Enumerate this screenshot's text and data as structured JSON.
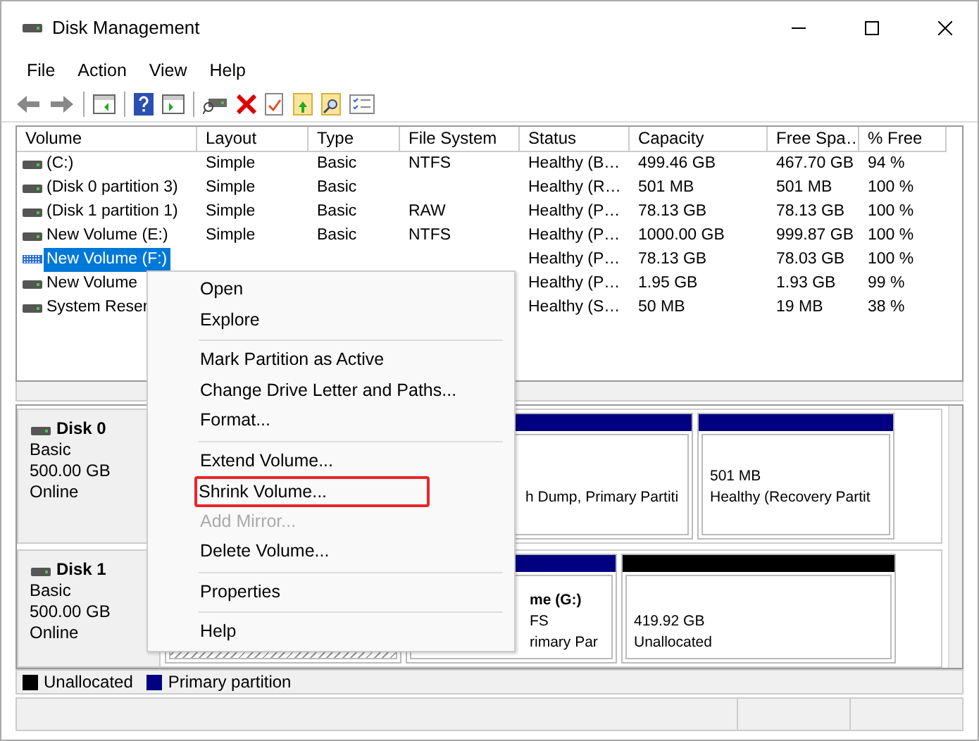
{
  "window": {
    "title": "Disk Management"
  },
  "menu_bar": [
    "File",
    "Action",
    "View",
    "Help"
  ],
  "volumes": {
    "columns": [
      "Volume",
      "Layout",
      "Type",
      "File System",
      "Status",
      "Capacity",
      "Free Spa…",
      "% Free"
    ],
    "rows": [
      {
        "selected": false,
        "cells": [
          "(C:)",
          "Simple",
          "Basic",
          "NTFS",
          "Healthy (B…",
          "499.46 GB",
          "467.70 GB",
          "94 %"
        ]
      },
      {
        "selected": false,
        "cells": [
          "(Disk 0 partition 3)",
          "Simple",
          "Basic",
          "",
          "Healthy (R…",
          "501 MB",
          "501 MB",
          "100 %"
        ]
      },
      {
        "selected": false,
        "cells": [
          "(Disk 1 partition 1)",
          "Simple",
          "Basic",
          "RAW",
          "Healthy (P…",
          "78.13 GB",
          "78.13 GB",
          "100 %"
        ]
      },
      {
        "selected": false,
        "cells": [
          "New Volume (E:)",
          "Simple",
          "Basic",
          "NTFS",
          "Healthy (P…",
          "1000.00 GB",
          "999.87 GB",
          "100 %"
        ]
      },
      {
        "selected": true,
        "cells": [
          "New Volume (F:)",
          "",
          "",
          "",
          "Healthy (P…",
          "78.13 GB",
          "78.03 GB",
          "100 %"
        ]
      },
      {
        "selected": false,
        "cells": [
          "New Volume",
          "",
          "",
          "",
          "Healthy (P…",
          "1.95 GB",
          "1.93 GB",
          "99 %"
        ]
      },
      {
        "selected": false,
        "cells": [
          "System Reser",
          "",
          "",
          "",
          "Healthy (S…",
          "50 MB",
          "19 MB",
          "38 %"
        ]
      }
    ]
  },
  "disks": [
    {
      "name": "Disk 0",
      "type": "Basic",
      "size": "500.00 GB",
      "state": "Online",
      "partitions": [
        {
          "color": "#000080",
          "selected": false,
          "lines": [
            "h Dump, Primary Partiti"
          ]
        },
        {
          "color": "#000080",
          "selected": false,
          "lines": [
            "501 MB",
            "Healthy (Recovery Partit"
          ]
        }
      ]
    },
    {
      "name": "Disk 1",
      "type": "Basic",
      "size": "500.00 GB",
      "state": "Online",
      "partitions": [
        {
          "selected": true
        },
        {
          "color": "#000080",
          "selected": false,
          "lines": [
            "**me  (G:)**",
            "FS",
            "rimary Par"
          ]
        },
        {
          "color": "#000000",
          "selected": false,
          "lines": [
            "419.92 GB",
            "Unallocated"
          ]
        }
      ]
    }
  ],
  "legend": [
    {
      "label": "Unallocated",
      "color": "#000000"
    },
    {
      "label": "Primary partition",
      "color": "#000080"
    }
  ],
  "context_menu": [
    {
      "kind": "item",
      "label": "Open",
      "disabled": false,
      "highlighted": false
    },
    {
      "kind": "item",
      "label": "Explore",
      "disabled": false,
      "highlighted": false
    },
    {
      "kind": "separator"
    },
    {
      "kind": "item",
      "label": "Mark Partition as Active",
      "disabled": false,
      "highlighted": false
    },
    {
      "kind": "item",
      "label": "Change Drive Letter and Paths...",
      "disabled": false,
      "highlighted": false
    },
    {
      "kind": "item",
      "label": "Format...",
      "disabled": false,
      "highlighted": false
    },
    {
      "kind": "separator"
    },
    {
      "kind": "item",
      "label": "Extend Volume...",
      "disabled": false,
      "highlighted": false
    },
    {
      "kind": "item",
      "label": "Shrink Volume...",
      "disabled": false,
      "highlighted": true
    },
    {
      "kind": "item",
      "label": "Add Mirror...",
      "disabled": true,
      "highlighted": false
    },
    {
      "kind": "item",
      "label": "Delete Volume...",
      "disabled": false,
      "highlighted": false
    },
    {
      "kind": "separator"
    },
    {
      "kind": "item",
      "label": "Properties",
      "disabled": false,
      "highlighted": false
    },
    {
      "kind": "separator"
    },
    {
      "kind": "item",
      "label": "Help",
      "disabled": false,
      "highlighted": false
    }
  ]
}
